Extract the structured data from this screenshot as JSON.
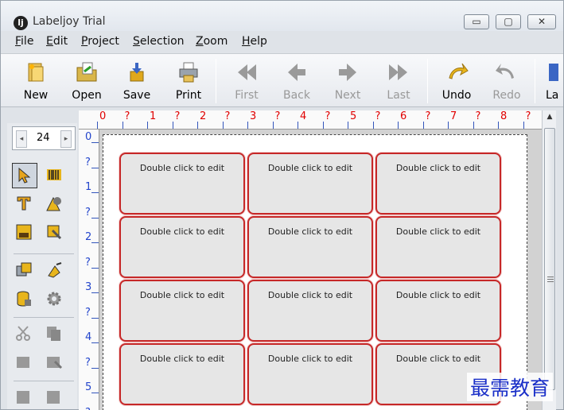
{
  "window": {
    "title": "Labeljoy Trial",
    "app_icon_glyph": "lj",
    "controls": {
      "minimize": "▭",
      "maximize": "▢",
      "close": "✕"
    }
  },
  "menu": [
    {
      "accel": "F",
      "rest": "ile"
    },
    {
      "accel": "E",
      "rest": "dit"
    },
    {
      "accel": "P",
      "rest": "roject"
    },
    {
      "accel": "S",
      "rest": "election"
    },
    {
      "accel": "Z",
      "rest": "oom"
    },
    {
      "accel": "H",
      "rest": "elp"
    }
  ],
  "toolbar": [
    {
      "label": "New",
      "icon": "new-document-icon",
      "enabled": true
    },
    {
      "label": "Open",
      "icon": "open-folder-icon",
      "enabled": true
    },
    {
      "label": "Save",
      "icon": "save-icon",
      "enabled": true
    },
    {
      "label": "Print",
      "icon": "printer-icon",
      "enabled": true
    },
    {
      "label": "First",
      "icon": "first-record-icon",
      "enabled": false
    },
    {
      "label": "Back",
      "icon": "back-arrow-icon",
      "enabled": false
    },
    {
      "label": "Next",
      "icon": "next-arrow-icon",
      "enabled": false
    },
    {
      "label": "Last",
      "icon": "last-record-icon",
      "enabled": false
    },
    {
      "label": "Undo",
      "icon": "undo-icon",
      "enabled": true
    },
    {
      "label": "Redo",
      "icon": "redo-icon",
      "enabled": false
    },
    {
      "label": "La",
      "icon": "layout-icon",
      "enabled": true
    }
  ],
  "tool_panel": {
    "zoom_value": "24",
    "zoom_left_arrow": "◂",
    "zoom_right_arrow": "▸",
    "tools": [
      {
        "name": "select-tool",
        "icon": "arrow-cursor-icon",
        "selected": true
      },
      {
        "name": "barcode-tool",
        "icon": "barcode-icon"
      },
      {
        "name": "text-tool",
        "icon": "text-t-icon"
      },
      {
        "name": "shape-tool",
        "icon": "shapes-icon"
      },
      {
        "name": "text-box-tool",
        "icon": "abc-text-box-icon"
      },
      {
        "name": "image-tool",
        "icon": "picture-icon"
      },
      {
        "name": "table-tool",
        "icon": "table-icon"
      },
      {
        "name": "paint-tool",
        "icon": "paint-bucket-icon"
      },
      {
        "name": "database-tool",
        "icon": "database-icon"
      },
      {
        "name": "settings-tool",
        "icon": "gear-icon"
      },
      {
        "name": "cut-tool",
        "icon": "scissors-icon"
      },
      {
        "name": "copy-tool",
        "icon": "copy-icon"
      },
      {
        "name": "bring-front-tool",
        "icon": "bring-to-front-icon"
      },
      {
        "name": "send-back-tool",
        "icon": "send-to-back-icon"
      },
      {
        "name": "align-tool",
        "icon": "align-icon"
      },
      {
        "name": "distribute-tool",
        "icon": "distribute-icon"
      }
    ]
  },
  "rulers": {
    "top": [
      "0",
      "?",
      "1",
      "?",
      "2",
      "?",
      "3",
      "?",
      "4",
      "?",
      "5",
      "?",
      "6",
      "?",
      "7",
      "?",
      "8",
      "?"
    ],
    "left": [
      "0",
      "?",
      "1",
      "?",
      "2",
      "?",
      "3",
      "?",
      "4",
      "?",
      "5",
      "?"
    ]
  },
  "labels": {
    "placeholder": "Double click to edit",
    "rows": 4,
    "cols": 3
  },
  "scrollbar": {
    "up_arrow": "▲",
    "grip": "≡"
  },
  "watermark": "最需教育",
  "colors": {
    "label_border": "#c62828",
    "ruler_numbers": "#e00000",
    "ruler_left_numbers": "#2244cc",
    "watermark": "#1a2fc8"
  }
}
